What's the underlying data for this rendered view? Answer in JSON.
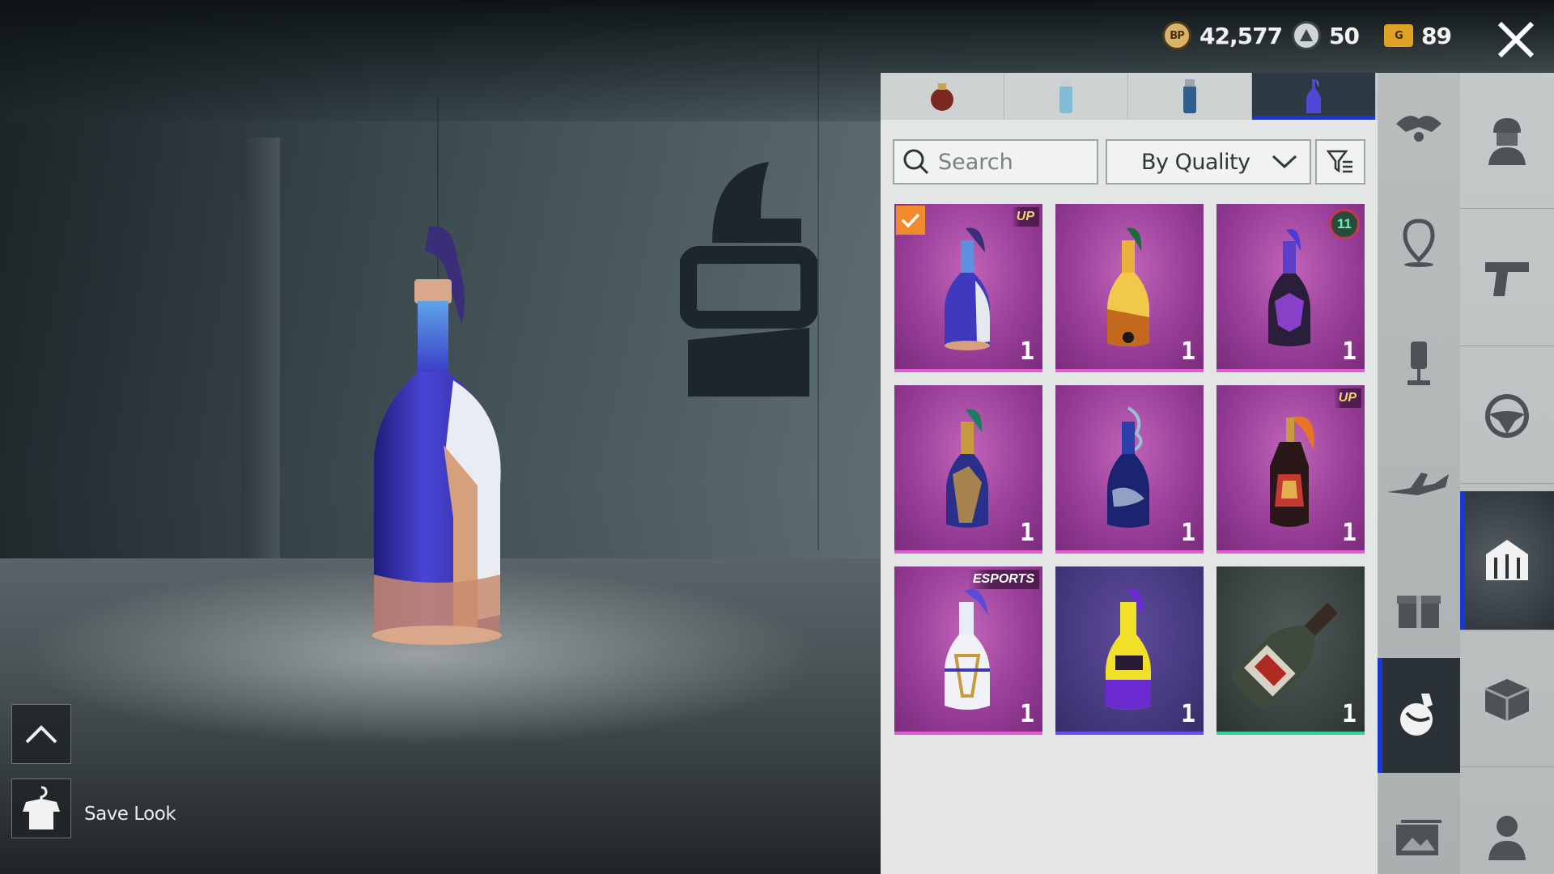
{
  "currency": {
    "bp": {
      "icon": "bp-coin-icon",
      "label": "BP",
      "value": "42,577"
    },
    "ag": {
      "icon": "ag-coin-icon",
      "value": "50"
    },
    "g": {
      "icon": "g-coin-icon",
      "label": "G",
      "value": "89"
    }
  },
  "inventory": {
    "tabs": [
      {
        "icon": "frag-grenade-icon",
        "active": false
      },
      {
        "icon": "smoke-grenade-icon",
        "active": false
      },
      {
        "icon": "stun-grenade-icon",
        "active": false
      },
      {
        "icon": "molotov-icon",
        "active": true
      }
    ],
    "search": {
      "placeholder": "Search",
      "value": ""
    },
    "sort": {
      "selected": "By Quality"
    },
    "items": [
      {
        "name": "molotov-skin-1",
        "quality": "purple",
        "badge": "UP",
        "equipped": true,
        "qty": "1"
      },
      {
        "name": "molotov-skin-2",
        "quality": "purple",
        "badge": "",
        "equipped": false,
        "qty": "1"
      },
      {
        "name": "molotov-skin-3",
        "quality": "purple",
        "badge": "11",
        "equipped": false,
        "qty": "1"
      },
      {
        "name": "molotov-skin-4",
        "quality": "purple",
        "badge": "",
        "equipped": false,
        "qty": "1"
      },
      {
        "name": "molotov-skin-5",
        "quality": "purple",
        "badge": "",
        "equipped": false,
        "qty": "1"
      },
      {
        "name": "molotov-skin-6",
        "quality": "purple",
        "badge": "UP",
        "equipped": false,
        "qty": "1"
      },
      {
        "name": "molotov-skin-7",
        "quality": "purple",
        "badge": "ESPORTS",
        "equipped": false,
        "qty": "1"
      },
      {
        "name": "molotov-skin-8",
        "quality": "blue",
        "badge": "",
        "equipped": false,
        "qty": "1"
      },
      {
        "name": "molotov-default",
        "quality": "grey",
        "badge": "",
        "equipped": false,
        "qty": "1"
      }
    ]
  },
  "rail_left": [
    "parachute-icon",
    "map-pin-icon",
    "microphone-icon",
    "airplane-icon",
    "gift-icon",
    "throwable-icon",
    "gallery-icon"
  ],
  "rail_right": [
    "character-icon",
    "gun-icon",
    "steering-wheel-icon",
    "helmet-vest-icon",
    "crate-icon",
    "avatar-icon"
  ],
  "save_look": {
    "label": "Save Look"
  },
  "colors": {
    "accent_blue": "#1a36d8",
    "equipped_orange": "#f08a2c",
    "epic_purple": "#9a3f9a",
    "epic_border": "#e35cd6",
    "rare_border": "#6b4ef0",
    "common_border": "#33d39a"
  }
}
